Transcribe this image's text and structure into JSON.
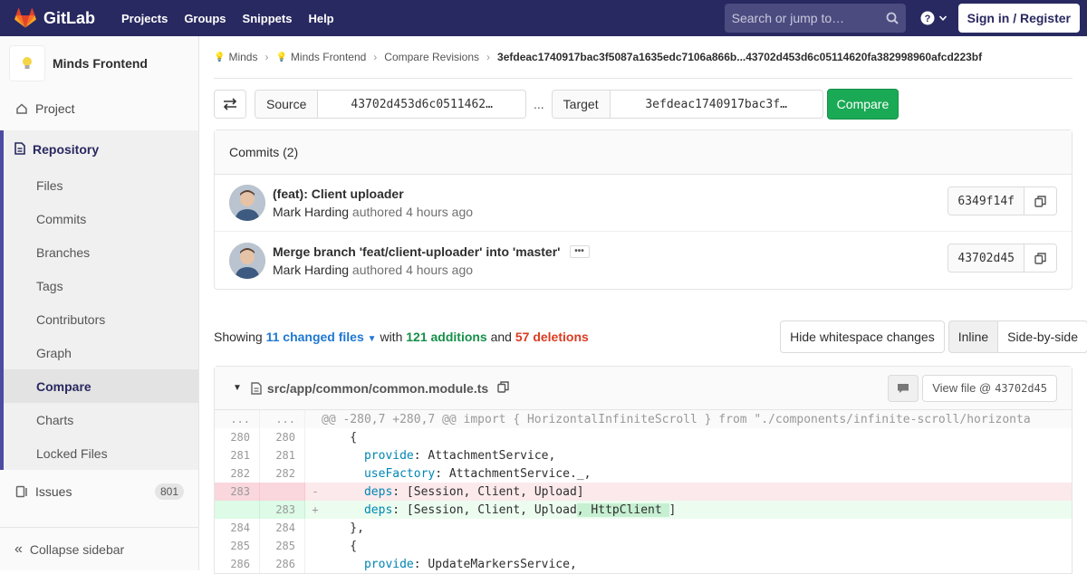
{
  "nav": {
    "brand": "GitLab",
    "links": [
      "Projects",
      "Groups",
      "Snippets",
      "Help"
    ],
    "search_placeholder": "Search or jump to…",
    "help_icon": "question-circle-icon",
    "signin_label": "Sign in / Register"
  },
  "sidebar": {
    "project_name": "Minds Frontend",
    "project_label": "Project",
    "repository_label": "Repository",
    "repo_items": [
      "Files",
      "Commits",
      "Branches",
      "Tags",
      "Contributors",
      "Graph",
      "Compare",
      "Charts",
      "Locked Files"
    ],
    "active_item": "Compare",
    "issues_label": "Issues",
    "issues_count": "801",
    "collapse_label": "Collapse sidebar"
  },
  "breadcrumb": {
    "items": [
      "Minds",
      "Minds Frontend",
      "Compare Revisions"
    ],
    "current": "3efdeac1740917bac3f5087a1635edc7106a866b...43702d453d6c05114620fa382998960afcd223bf"
  },
  "compare": {
    "source_label": "Source",
    "source_value": "43702d453d6c0511462…",
    "dots": "...",
    "target_label": "Target",
    "target_value": "3efdeac1740917bac3f…",
    "compare_button": "Compare"
  },
  "commits": {
    "header": "Commits (2)",
    "items": [
      {
        "title": "(feat): Client uploader",
        "author": "Mark Harding",
        "authored": "authored 4 hours ago",
        "sha": "6349f14f",
        "has_ellipsis": false
      },
      {
        "title": "Merge branch 'feat/client-uploader' into 'master'",
        "author": "Mark Harding",
        "authored": "authored 4 hours ago",
        "sha": "43702d45",
        "has_ellipsis": true
      }
    ]
  },
  "summary": {
    "showing": "Showing",
    "changed_files": "11 changed files",
    "with": "with",
    "additions": "121 additions",
    "and": "and",
    "deletions": "57 deletions",
    "hide_whitespace": "Hide whitespace changes",
    "inline": "Inline",
    "side_by_side": "Side-by-side"
  },
  "file": {
    "path": "src/app/common/common.module.ts",
    "view_file_label": "View file @",
    "view_file_sha": "43702d45",
    "hunk_header": "@@ -280,7 +280,7 @@ import { HorizontalInfiniteScroll } from \"./components/infinite-scroll/horizonta",
    "lines": [
      {
        "type": "ctx",
        "old": "280",
        "new": "280",
        "code": "    {"
      },
      {
        "type": "ctx",
        "old": "281",
        "new": "281",
        "kw": "provide",
        "rest": ": AttachmentService,"
      },
      {
        "type": "ctx",
        "old": "282",
        "new": "282",
        "kw": "useFactory",
        "rest": ": AttachmentService._,"
      },
      {
        "type": "old",
        "old": "283",
        "new": "",
        "sign": "-",
        "kw": "deps",
        "rest": ": [Session, Client, Upload]"
      },
      {
        "type": "new",
        "old": "",
        "new": "283",
        "sign": "+",
        "kw": "deps",
        "rest": ": [Session, Client, Upload",
        "added": ", HttpClient ",
        "tail": "]"
      },
      {
        "type": "ctx",
        "old": "284",
        "new": "284",
        "code": "    },"
      },
      {
        "type": "ctx",
        "old": "285",
        "new": "285",
        "code": "    {"
      },
      {
        "type": "ctx",
        "old": "286",
        "new": "286",
        "kw": "provide",
        "rest": ": UpdateMarkersService,"
      }
    ]
  }
}
